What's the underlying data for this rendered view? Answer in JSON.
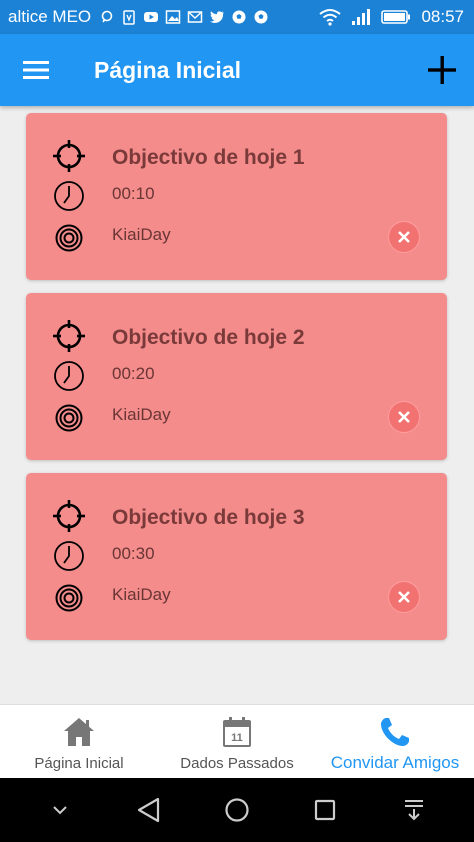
{
  "status_bar": {
    "carrier": "altice MEO",
    "time": "08:57"
  },
  "app_bar": {
    "title": "Página Inicial"
  },
  "goals": [
    {
      "title": "Objectivo de hoje 1",
      "time": "00:10",
      "app": "KiaiDay"
    },
    {
      "title": "Objectivo de hoje 2",
      "time": "00:20",
      "app": "KiaiDay"
    },
    {
      "title": "Objectivo de hoje 3",
      "time": "00:30",
      "app": "KiaiDay"
    }
  ],
  "bottom_nav": {
    "items": [
      {
        "label": "Página Inicial",
        "icon": "home-icon"
      },
      {
        "label": "Dados Passados",
        "icon": "calendar-icon",
        "badge": "11"
      },
      {
        "label": "Convidar Amigos",
        "icon": "phone-icon",
        "active": true
      }
    ]
  },
  "colors": {
    "primary": "#2196f3",
    "status_bar": "#1c82d6",
    "card": "#f48c8c",
    "card_title": "#7a3a3a",
    "delete": "#f27272"
  }
}
